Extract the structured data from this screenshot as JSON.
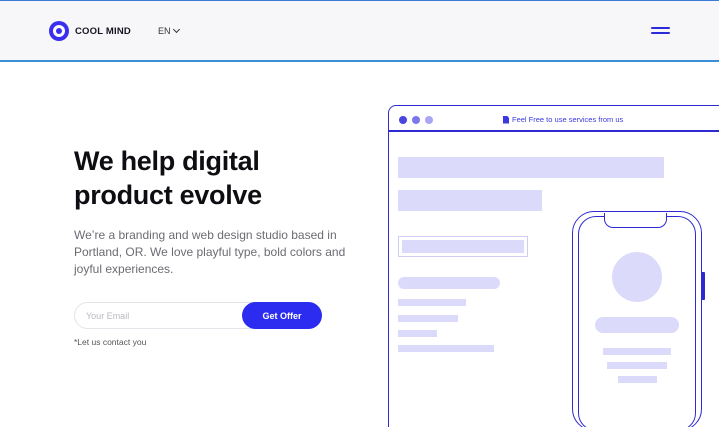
{
  "header": {
    "logo_text": "COOL MIND",
    "language": "EN",
    "menu_icon": "hamburger-icon"
  },
  "hero": {
    "title_line1": "We help digital",
    "title_line2": "product evolve",
    "description": "We’re a branding and web design studio based in Portland, OR. We love playful type, bold colors and joyful experiences.",
    "email_placeholder": "Your Email",
    "button_label": "Get Offer",
    "note": "*Let us contact you"
  },
  "illustration": {
    "url_text": "Feel Free to use services from us",
    "url_icon": "document-icon"
  },
  "colors": {
    "accent": "#2b2cf0",
    "outline": "#2e2ad1",
    "placeholder_block": "#dcdafb",
    "header_border": "#3a8fd8"
  }
}
